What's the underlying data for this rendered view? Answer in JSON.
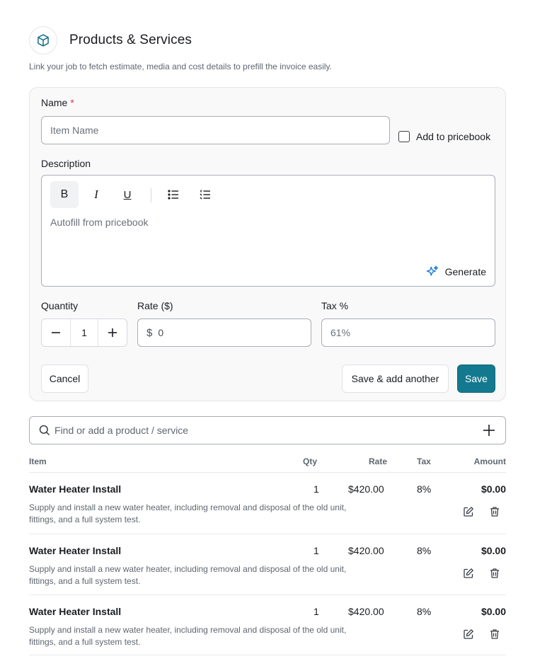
{
  "header": {
    "title": "Products & Services",
    "subtitle": "Link your job to fetch estimate, media and cost details to prefill the invoice easily.",
    "icon": "box-icon"
  },
  "form": {
    "name_label": "Name",
    "required_mark": "*",
    "name_placeholder": "Item Name",
    "pricebook_label": "Add to pricebook",
    "description_label": "Description",
    "toolbar": {
      "bold": "B",
      "italic": "I",
      "underline": "U"
    },
    "description_placeholder": "Autofill from pricebook",
    "generate_label": "Generate",
    "quantity_label": "Quantity",
    "quantity_value": "1",
    "rate_label": "Rate ($)",
    "rate_prefix": "$",
    "rate_value": "0",
    "tax_label": "Tax %",
    "tax_value": "61%",
    "cancel_label": "Cancel",
    "save_add_label": "Save & add another",
    "save_label": "Save"
  },
  "search": {
    "placeholder": "Find or add a product / service"
  },
  "table": {
    "columns": {
      "item": "Item",
      "qty": "Qty",
      "rate": "Rate",
      "tax": "Tax",
      "amount": "Amount"
    },
    "rows": [
      {
        "name": "Water Heater Install",
        "description": "Supply and install a new water heater, including removal and disposal of the old unit, fittings, and a full system test.",
        "qty": "1",
        "rate": "$420.00",
        "tax": "8%",
        "amount": "$0.00"
      },
      {
        "name": "Water Heater Install",
        "description": "Supply and install a new water heater, including removal and disposal of the old unit, fittings, and a full system test.",
        "qty": "1",
        "rate": "$420.00",
        "tax": "8%",
        "amount": "$0.00"
      },
      {
        "name": "Water Heater Install",
        "description": "Supply and install a new water heater, including removal and disposal of the old unit, fittings, and a full system test.",
        "qty": "1",
        "rate": "$420.00",
        "tax": "8%",
        "amount": "$0.00"
      }
    ]
  },
  "colors": {
    "primary": "#13798e",
    "accent_icon": "#1877d4",
    "required": "#d93636"
  }
}
